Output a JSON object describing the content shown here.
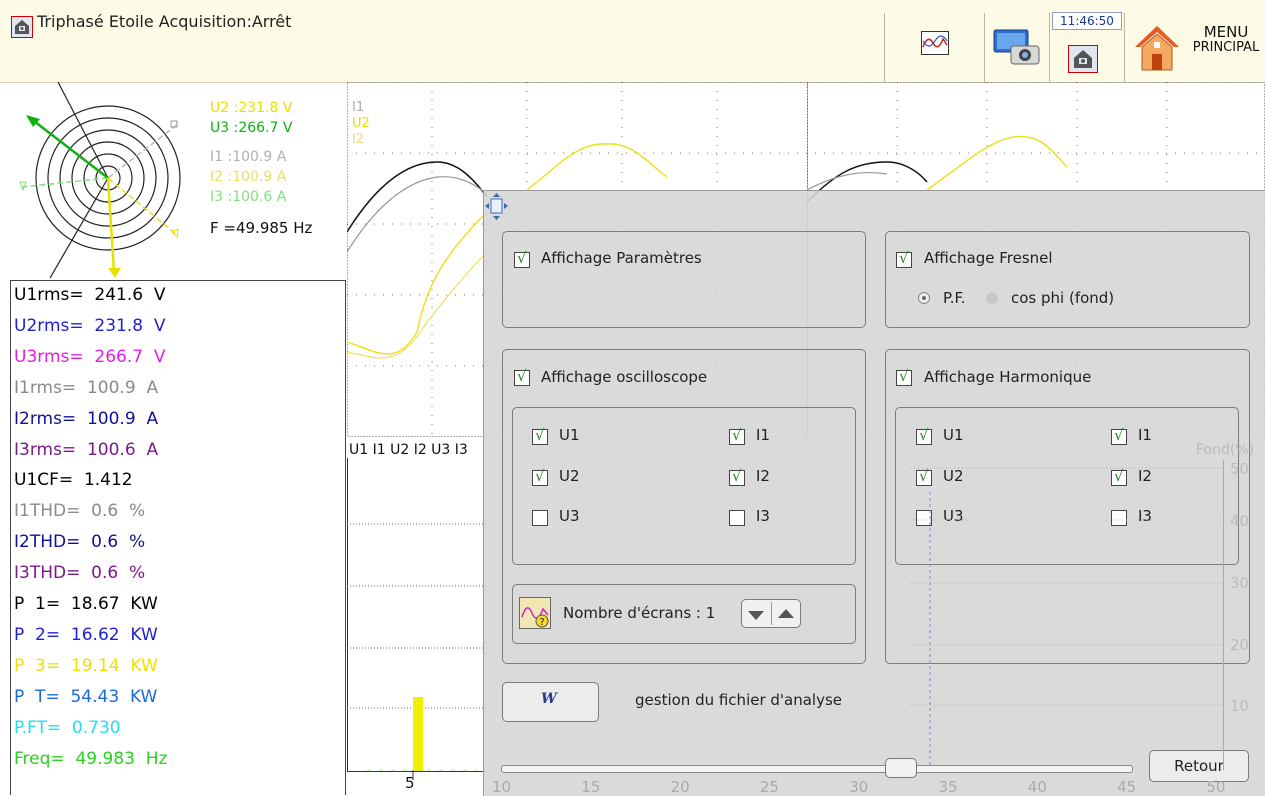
{
  "header": {
    "title": "Triphasé Etoile Acquisition:Arrêt",
    "clock": "11:46:50",
    "menu_line1": "MENU",
    "menu_line2": "PRINCIPAL"
  },
  "fresnel": {
    "u2": "U2 :231.8 V",
    "u3": "U3 :266.7 V",
    "i1": "I1 :100.9 A",
    "i2": "I2 :100.9 A",
    "i3": "I3 :100.6 A",
    "freq": "F  =49.985 Hz"
  },
  "params": [
    {
      "text": "U1rms=  241.6  V",
      "color": "#000000"
    },
    {
      "text": "U2rms=  231.8  V",
      "color": "#1f1fd6"
    },
    {
      "text": "U3rms=  266.7  V",
      "color": "#e020e0"
    },
    {
      "text": "I1rms=  100.9  A",
      "color": "#8a8a8a"
    },
    {
      "text": "I2rms=  100.9  A",
      "color": "#101090"
    },
    {
      "text": "I3rms=  100.6  A",
      "color": "#7a1a8a"
    },
    {
      "text": "U1CF=  1.412",
      "color": "#000000"
    },
    {
      "text": "I1THD=  0.6  %",
      "color": "#8a8a8a"
    },
    {
      "text": "I2THD=  0.6  %",
      "color": "#101090"
    },
    {
      "text": "I3THD=  0.6  %",
      "color": "#7a1a8a"
    },
    {
      "text": "P  1=  18.67  KW",
      "color": "#000000"
    },
    {
      "text": "P  2=  16.62  KW",
      "color": "#1f1fd6"
    },
    {
      "text": "P  3=  19.14  KW",
      "color": "#f0e000"
    },
    {
      "text": "P  T=  54.43  KW",
      "color": "#1a6ad8"
    },
    {
      "text": "P.FT=  0.730",
      "color": "#20e0f0"
    },
    {
      "text": "Freq=  49.983  Hz",
      "color": "#2ad020"
    }
  ],
  "scope": {
    "legend_i1": "I1",
    "legend_u2": "U2",
    "legend_i2": "I2"
  },
  "harmonics": {
    "legend": "U1 I1 U2 I2 U3 I3",
    "fond_label": "Fond(%)",
    "x_tick": "5",
    "pct_ticks": [
      "50",
      "40",
      "30",
      "20",
      "10"
    ],
    "scale_ticks": [
      "10",
      "15",
      "20",
      "25",
      "30",
      "35",
      "40",
      "45",
      "50"
    ]
  },
  "dialog": {
    "params_label": "Affichage Paramètres",
    "fresnel_label": "Affichage Fresnel",
    "pf_label": "P.F.",
    "cosphi_label": "cos phi (fond)",
    "scope_label": "Affichage oscilloscope",
    "harm_label": "Affichage Harmonique",
    "scope_channels": {
      "u1": "U1",
      "u2": "U2",
      "u3": "U3",
      "i1": "I1",
      "i2": "I2",
      "i3": "I3"
    },
    "harm_channels": {
      "u1": "U1",
      "u2": "U2",
      "u3": "U3",
      "i1": "I1",
      "i2": "I2",
      "i3": "I3"
    },
    "screens_label": "Nombre d'écrans : 1",
    "file_button_icon": "W",
    "file_label": "gestion du fichier d'analyse",
    "back_label": "Retour"
  }
}
